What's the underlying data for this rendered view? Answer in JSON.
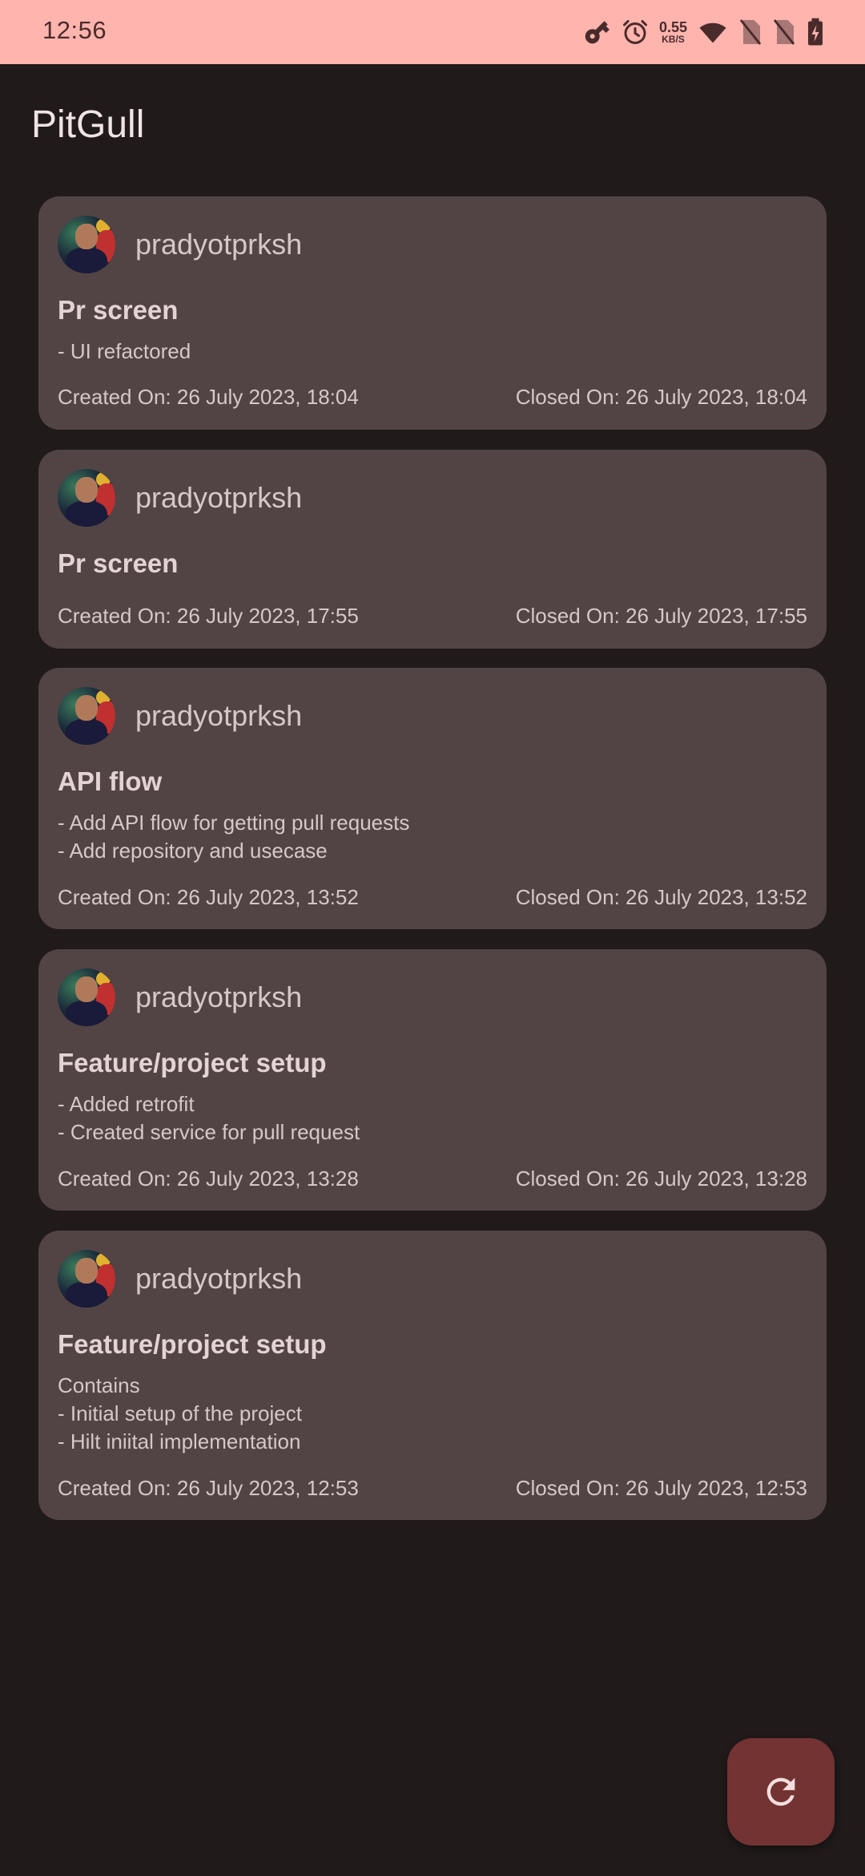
{
  "status_bar": {
    "time": "12:56",
    "net_speed_value": "0.55",
    "net_speed_unit": "KB/S",
    "icons": [
      "vpn-key-icon",
      "alarm-icon",
      "wifi-icon",
      "no-sim-icon",
      "no-sim-icon",
      "battery-charging-icon"
    ]
  },
  "app": {
    "title": "PitGull"
  },
  "pull_requests": [
    {
      "author": "pradyotprksh",
      "title": "Pr screen",
      "description": "- UI refactored",
      "created": "Created On: 26 July 2023, 18:04",
      "closed": "Closed On: 26 July 2023, 18:04"
    },
    {
      "author": "pradyotprksh",
      "title": "Pr screen",
      "description": "",
      "created": "Created On: 26 July 2023, 17:55",
      "closed": "Closed On: 26 July 2023, 17:55"
    },
    {
      "author": "pradyotprksh",
      "title": "API flow",
      "description": "- Add API flow for getting pull requests\n- Add repository and usecase",
      "created": "Created On: 26 July 2023, 13:52",
      "closed": "Closed On: 26 July 2023, 13:52"
    },
    {
      "author": "pradyotprksh",
      "title": "Feature/project setup",
      "description": "- Added retrofit\n- Created service for pull request",
      "created": "Created On: 26 July 2023, 13:28",
      "closed": "Closed On: 26 July 2023, 13:28"
    },
    {
      "author": "pradyotprksh",
      "title": "Feature/project setup",
      "description": "Contains\n- Initial setup of the project\n- Hilt iniital implementation",
      "created": "Created On: 26 July 2023, 12:53",
      "closed": "Closed On: 26 July 2023, 12:53"
    }
  ],
  "fab": {
    "icon": "refresh-icon"
  },
  "colors": {
    "status_bar": "#ffb4ae",
    "background": "#201a1b",
    "card": "#524445",
    "fab": "#733333"
  }
}
